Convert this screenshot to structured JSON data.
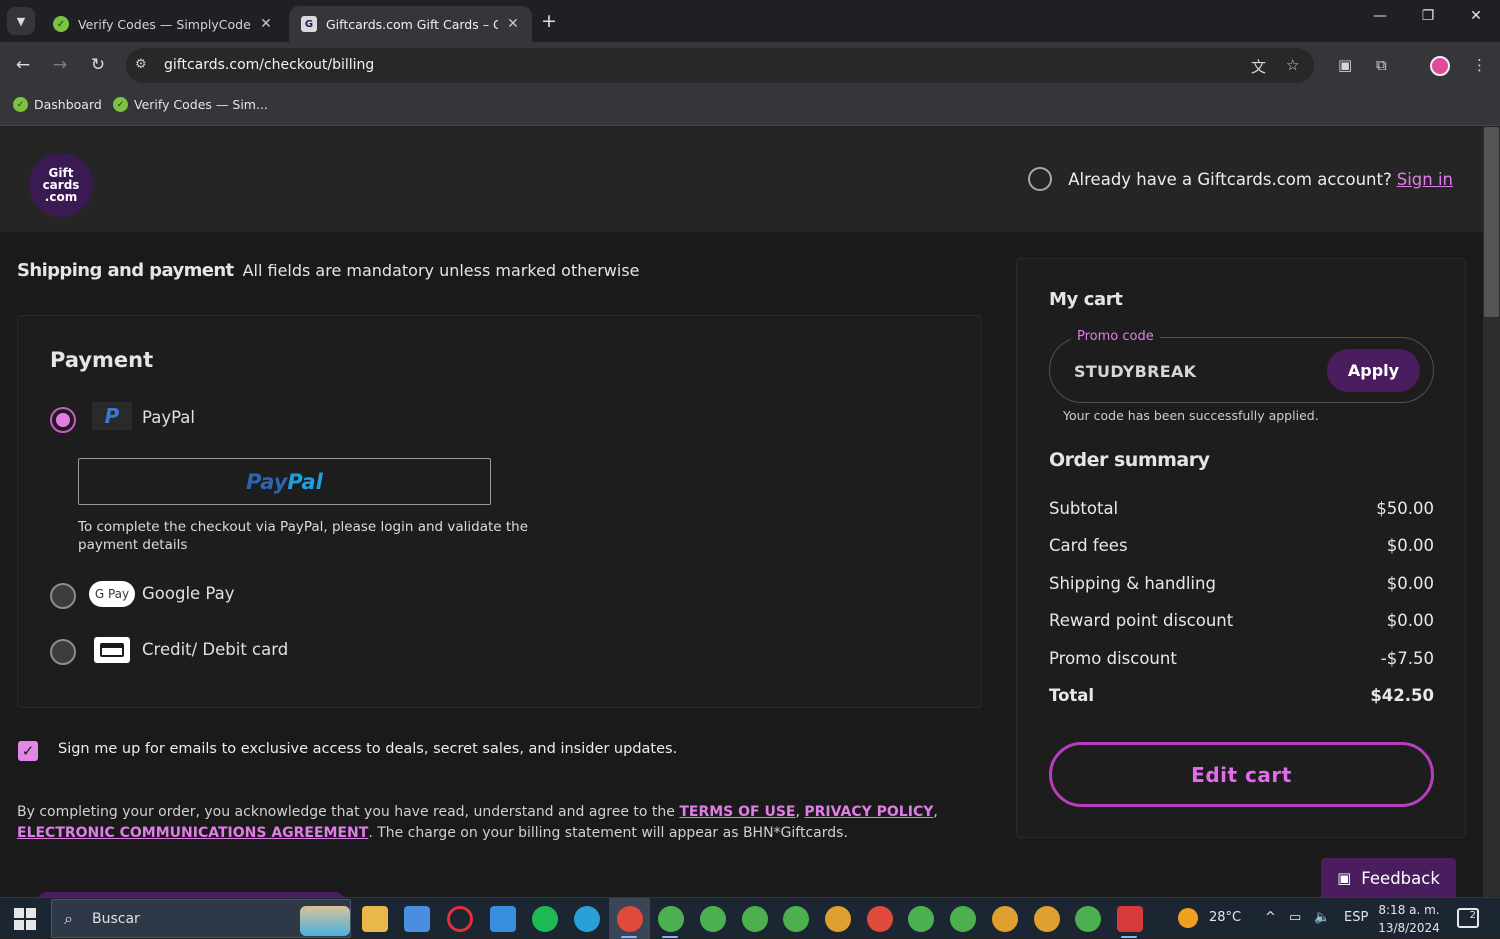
{
  "browser": {
    "tabs": [
      {
        "title": "Verify Codes — SimplyCodes",
        "active": false
      },
      {
        "title": "Giftcards.com Gift Cards – Giftc",
        "active": true
      }
    ],
    "url": "giftcards.com/checkout/billing",
    "bookmarks": [
      {
        "label": "Dashboard"
      },
      {
        "label": "Verify Codes — Sim..."
      }
    ]
  },
  "header": {
    "logo_text": "Gift cards .com",
    "account_prompt": "Already have a Giftcards.com account?",
    "sign_in": "Sign in"
  },
  "checkout": {
    "section_title": "Shipping and payment",
    "section_note": "All fields are mandatory unless marked otherwise",
    "payment_title": "Payment",
    "methods": [
      {
        "label": "PayPal",
        "selected": true
      },
      {
        "label": "Google Pay",
        "selected": false
      },
      {
        "label": "Credit/ Debit card",
        "selected": false
      }
    ],
    "paypal_button": {
      "pay": "Pay",
      "pal": "Pal"
    },
    "paypal_note": "To complete the checkout via PayPal, please login and validate the payment details",
    "gpay_badge": "G Pay",
    "email_optin": {
      "checked": true,
      "label": "Sign me up for emails to exclusive access to deals, secret sales, and insider updates."
    },
    "legal": {
      "before": "By completing your order, you acknowledge that you have read, understand and agree to the ",
      "terms": "TERMS OF USE",
      "sep1": ", ",
      "privacy": "PRIVACY POLICY",
      "sep2": ", ",
      "electronic": "ELECTRONIC COMMUNICATIONS AGREEMENT",
      "after": ". The charge on your billing statement will appear as BHN*Giftcards."
    }
  },
  "cart": {
    "title": "My cart",
    "promo_label": "Promo code",
    "promo_value": "STUDYBREAK",
    "apply": "Apply",
    "promo_success": "Your code has been successfully applied.",
    "summary_title": "Order summary",
    "rows": [
      {
        "label": "Subtotal",
        "value": "$50.00"
      },
      {
        "label": "Card fees",
        "value": "$0.00"
      },
      {
        "label": "Shipping & handling",
        "value": "$0.00"
      },
      {
        "label": "Reward point discount",
        "value": "$0.00"
      },
      {
        "label": "Promo discount",
        "value": "-$7.50"
      },
      {
        "label": "Total",
        "value": "$42.50"
      }
    ],
    "edit_cart": "Edit cart"
  },
  "feedback": "Feedback",
  "taskbar": {
    "search": "Buscar",
    "weather": "28°C",
    "language": "ESP",
    "time": "8:18 a. m.",
    "date": "13/8/2024",
    "notifications": "2"
  },
  "colors": {
    "accent": "#e17de9",
    "brand_purple": "#4a1e5e",
    "page_bg": "#1a1a1a"
  }
}
